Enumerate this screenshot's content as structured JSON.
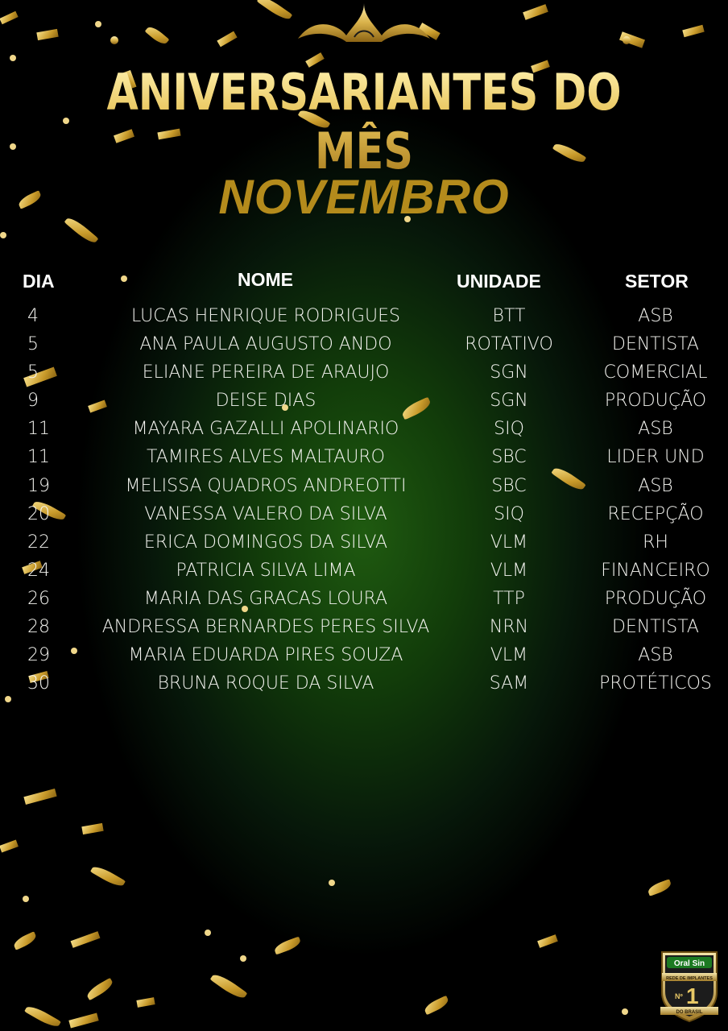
{
  "header": {
    "title": "ANIVERSARIANTES DO MÊS",
    "month": "NOVEMBRO"
  },
  "table": {
    "columns": [
      "DIA",
      "NOME",
      "UNIDADE",
      "SETOR"
    ],
    "rows": [
      {
        "dia": "4",
        "nome": "LUCAS HENRIQUE RODRIGUES",
        "unidade": "BTT",
        "setor": "ASB"
      },
      {
        "dia": "5",
        "nome": "ANA PAULA AUGUSTO ANDO",
        "unidade": "ROTATIVO",
        "setor": "DENTISTA"
      },
      {
        "dia": "5",
        "nome": "ELIANE PEREIRA DE ARAUJO",
        "unidade": "SGN",
        "setor": "COMERCIAL"
      },
      {
        "dia": "9",
        "nome": "DEISE DIAS",
        "unidade": "SGN",
        "setor": "PRODUÇÃO"
      },
      {
        "dia": "11",
        "nome": "MAYARA GAZALLI APOLINARIO",
        "unidade": "SIQ",
        "setor": "ASB"
      },
      {
        "dia": "11",
        "nome": "TAMIRES ALVES MALTAURO",
        "unidade": "SBC",
        "setor": "LIDER UND"
      },
      {
        "dia": "19",
        "nome": "MELISSA QUADROS ANDREOTTI",
        "unidade": "SBC",
        "setor": "ASB"
      },
      {
        "dia": "20",
        "nome": "VANESSA VALERO DA SILVA",
        "unidade": "SIQ",
        "setor": "RECEPÇÃO"
      },
      {
        "dia": "22",
        "nome": "ERICA DOMINGOS DA SILVA",
        "unidade": "VLM",
        "setor": "RH"
      },
      {
        "dia": "24",
        "nome": "PATRICIA SILVA LIMA",
        "unidade": "VLM",
        "setor": "FINANCEIRO"
      },
      {
        "dia": "26",
        "nome": "MARIA DAS GRACAS LOURA",
        "unidade": "TTP",
        "setor": "PRODUÇÃO"
      },
      {
        "dia": "28",
        "nome": "ANDRESSA BERNARDES PERES SILVA",
        "unidade": "NRN",
        "setor": "DENTISTA"
      },
      {
        "dia": "29",
        "nome": "MARIA EDUARDA PIRES SOUZA",
        "unidade": "VLM",
        "setor": "ASB"
      },
      {
        "dia": "30",
        "nome": "BRUNA ROQUE DA SILVA",
        "unidade": "SAM",
        "setor": "PROTÉTICOS"
      }
    ]
  },
  "badge": {
    "brand": "Oral Sin",
    "tagline": "REDE DE IMPLANTES",
    "rank": "Nº1",
    "subtitle": "DO BRASIL"
  },
  "colors": {
    "gold": "#e5c45c",
    "month_gold": "#b48b1c",
    "background_center": "#1f5a10",
    "background_edge": "#000000"
  }
}
